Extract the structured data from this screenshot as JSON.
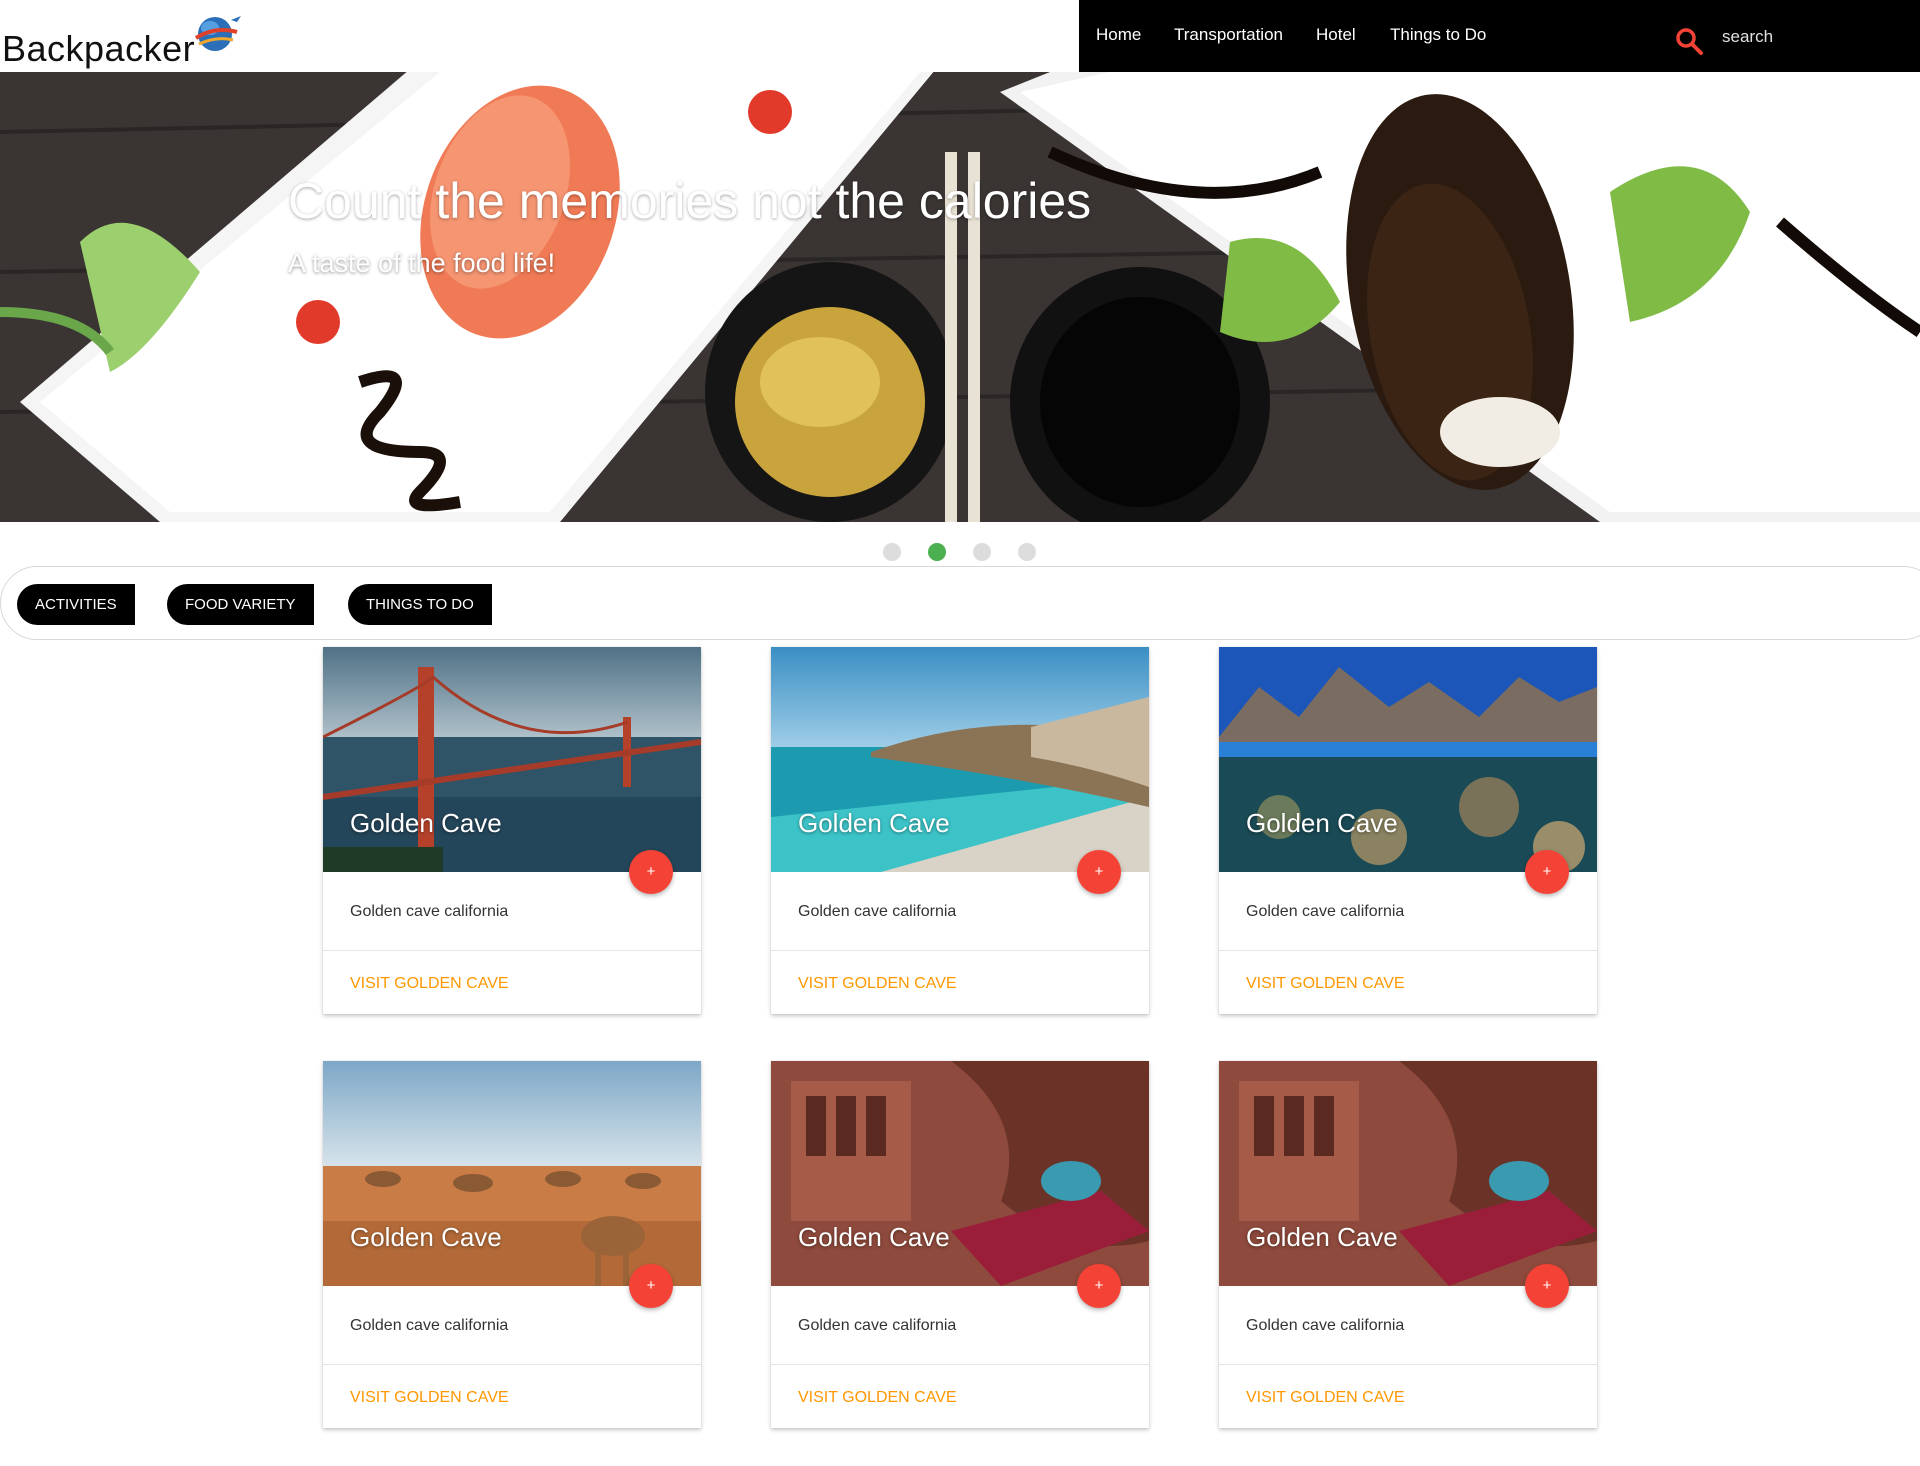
{
  "brand": {
    "name": "Backpacker",
    "logo_icon": "globe-plane-logo-icon"
  },
  "nav": {
    "items": [
      "Home",
      "Transportation",
      "Hotel",
      "Things to Do"
    ],
    "search_placeholder": "search",
    "search_icon": "search-icon",
    "accent_color": "#f44336"
  },
  "hero": {
    "title": "Count the memories not the calories",
    "subtitle": "A taste of the food life!"
  },
  "carousel": {
    "slides": 4,
    "active_index": 1,
    "active_color": "#4caf50"
  },
  "tabs": [
    "ACTIVITIES",
    "FOOD VARIETY",
    "THINGS TO DO"
  ],
  "cards": [
    {
      "title": "Golden Cave",
      "description": "Golden cave california",
      "link": "VISIT GOLDEN CAVE",
      "fab": "+"
    },
    {
      "title": "Golden Cave",
      "description": "Golden cave california",
      "link": "VISIT GOLDEN CAVE",
      "fab": "+"
    },
    {
      "title": "Golden Cave",
      "description": "Golden cave california",
      "link": "VISIT GOLDEN CAVE",
      "fab": "+"
    },
    {
      "title": "Golden Cave",
      "description": "Golden cave california",
      "link": "VISIT GOLDEN CAVE",
      "fab": "+"
    },
    {
      "title": "Golden Cave",
      "description": "Golden cave california",
      "link": "VISIT GOLDEN CAVE",
      "fab": "+"
    },
    {
      "title": "Golden Cave",
      "description": "Golden cave california",
      "link": "VISIT GOLDEN CAVE",
      "fab": "+"
    }
  ],
  "colors": {
    "link": "#ff9800",
    "fab": "#f44336",
    "nav_bg": "#000000"
  }
}
